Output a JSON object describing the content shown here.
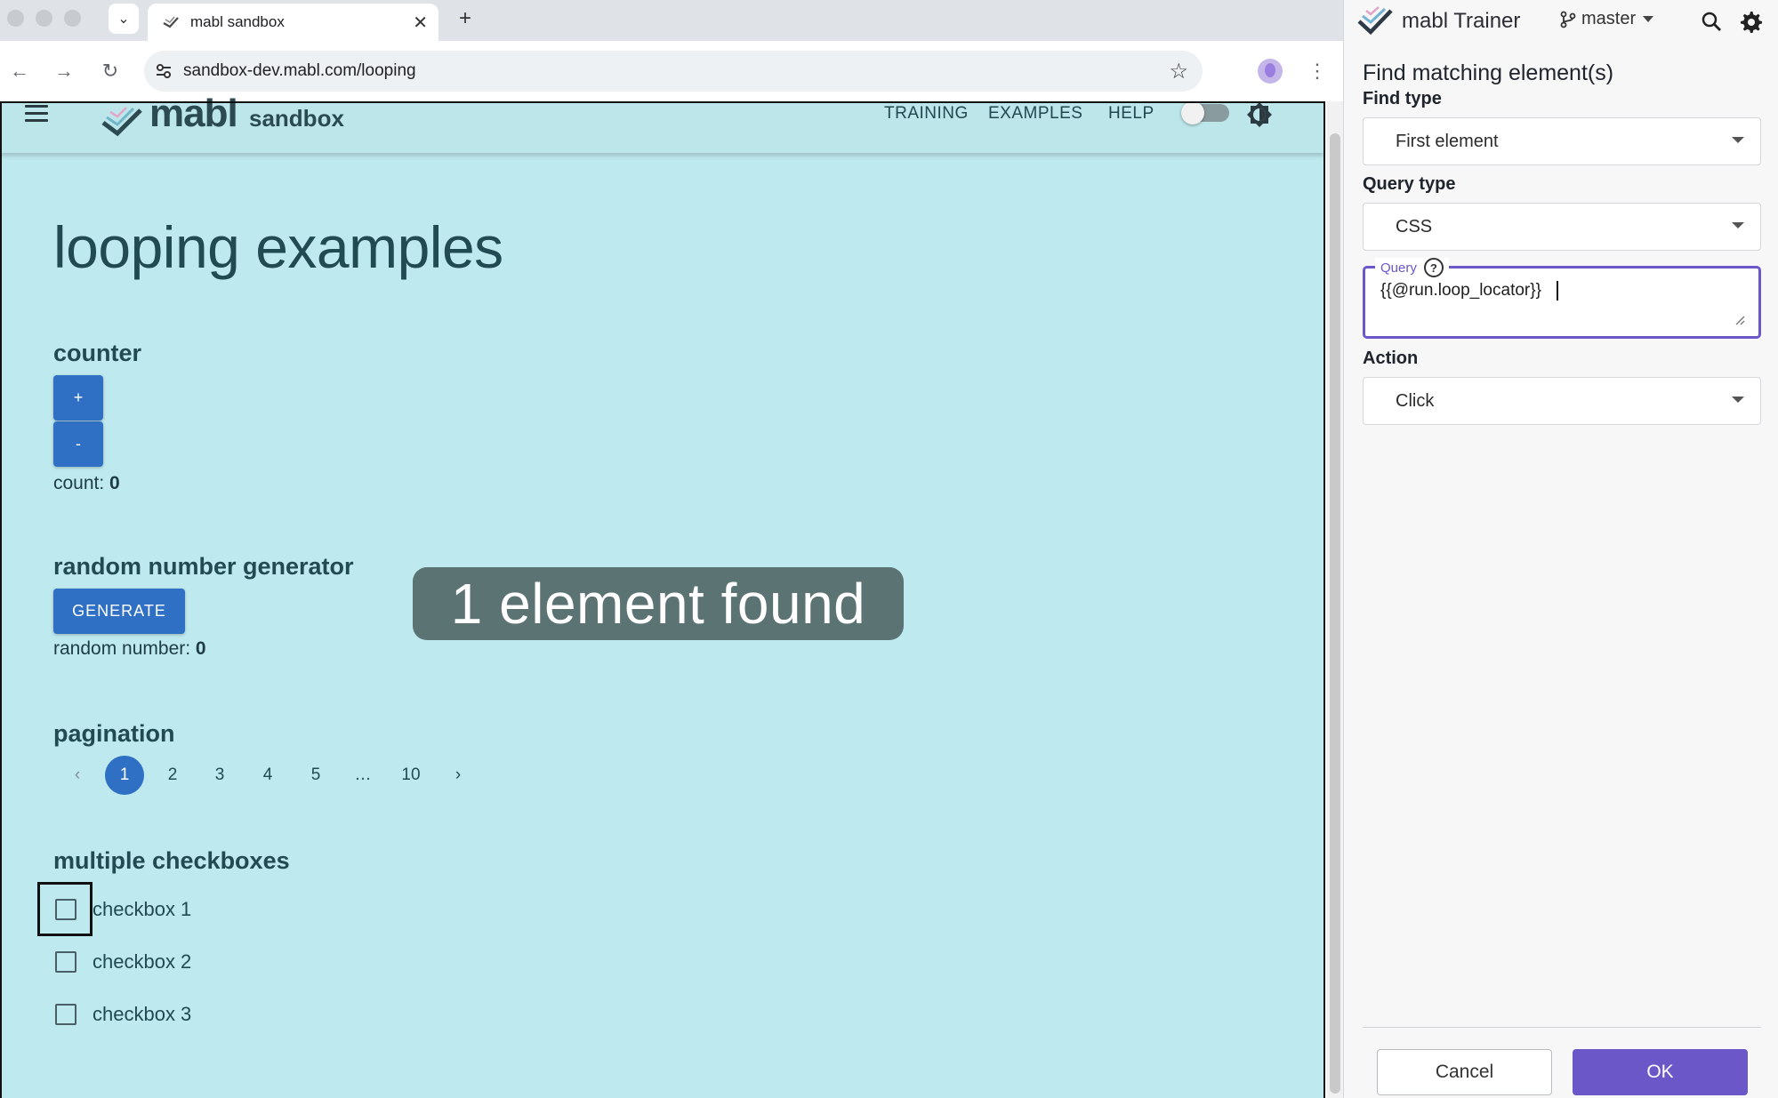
{
  "browser": {
    "tab_title": "mabl sandbox",
    "url": "sandbox-dev.mabl.com/looping"
  },
  "site": {
    "logo_text": "mabl",
    "logo_sub": "sandbox",
    "nav": [
      "TRAINING",
      "EXAMPLES",
      "HELP"
    ],
    "title": "looping examples",
    "counter": {
      "heading": "counter",
      "plus_label": "+",
      "minus_label": "-",
      "count_label": "count: ",
      "count_value": "0"
    },
    "rng": {
      "heading": "random number generator",
      "button_label": "GENERATE",
      "result_label": "random number: ",
      "result_value": "0"
    },
    "pagination": {
      "heading": "pagination",
      "prev": "‹",
      "pages": [
        "1",
        "2",
        "3",
        "4",
        "5",
        "…",
        "10"
      ],
      "next": "›",
      "active_page": "1"
    },
    "checkboxes": {
      "heading": "multiple checkboxes",
      "items": [
        "checkbox 1",
        "checkbox 2",
        "checkbox 3"
      ]
    },
    "toast": "1 element found"
  },
  "trainer": {
    "title": "mabl Trainer",
    "branch": "master",
    "heading": "Find matching element(s)",
    "find_type_label": "Find type",
    "find_type_value": "First element",
    "query_type_label": "Query type",
    "query_type_value": "CSS",
    "query_label": "Query",
    "query_value": "{{@run.loop_locator}}",
    "action_label": "Action",
    "action_value": "Click",
    "cancel_label": "Cancel",
    "ok_label": "OK"
  },
  "colors": {
    "page_bg": "#bee9ee",
    "primary_button": "#2f6fc4",
    "trainer_accent": "#6b57c8",
    "toast_bg": "#5c7374"
  },
  "icons": [
    "chevron-down-icon",
    "close-icon",
    "plus-icon",
    "back-icon",
    "forward-icon",
    "reload-icon",
    "site-settings-icon",
    "star-icon",
    "profile-icon",
    "kebab-icon",
    "hamburger-icon",
    "theme-toggle-icon",
    "branch-icon",
    "search-icon",
    "gear-icon",
    "help-icon",
    "dropdown-arrow-icon",
    "resize-handle-icon"
  ]
}
